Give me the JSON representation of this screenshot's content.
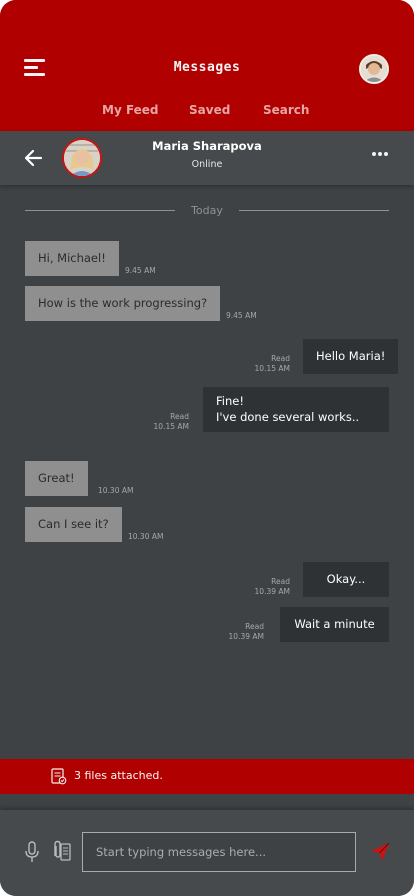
{
  "header": {
    "title": "Messages",
    "tabs": [
      {
        "label": "My Feed"
      },
      {
        "label": "Saved"
      },
      {
        "label": "Search"
      }
    ]
  },
  "chat": {
    "contact_name": "Maria Sharapova",
    "contact_status": "Online",
    "date_divider": "Today"
  },
  "messages": [
    {
      "direction": "incoming",
      "text": "Hi, Michael!",
      "time": "9.45 AM"
    },
    {
      "direction": "incoming",
      "text": "How is the work progressing?",
      "time": "9.45 AM"
    },
    {
      "direction": "outgoing",
      "text": "Hello Maria!",
      "status": "Read",
      "time": "10.15 AM"
    },
    {
      "direction": "outgoing",
      "lines": [
        "Fine!",
        "I've done several works.."
      ],
      "status": "Read",
      "time": "10.15 AM"
    },
    {
      "direction": "incoming",
      "text": "Great!",
      "time": "10.30 AM"
    },
    {
      "direction": "incoming",
      "text": "Can I see it?",
      "time": "10.30 AM"
    },
    {
      "direction": "outgoing",
      "text": "Okay...",
      "status": "Read",
      "time": "10.39 AM"
    },
    {
      "direction": "outgoing",
      "text": "Wait a minute",
      "status": "Read",
      "time": "10.39 AM"
    }
  ],
  "attachments": {
    "label": "3 files attached."
  },
  "composer": {
    "placeholder": "Start typing messages here..."
  },
  "icons": {
    "menu": "menu-icon",
    "back": "back-arrow-icon",
    "more": "more-dots-icon",
    "attach_file": "file-attachment-icon",
    "mic": "microphone-icon",
    "clip": "paperclip-icon",
    "send": "send-icon"
  },
  "colors": {
    "brand_red": "#b00000",
    "background": "#3e4244",
    "incoming_bubble": "#8f8f8f",
    "outgoing_bubble": "#2f3234",
    "send_accent": "#c81414"
  }
}
